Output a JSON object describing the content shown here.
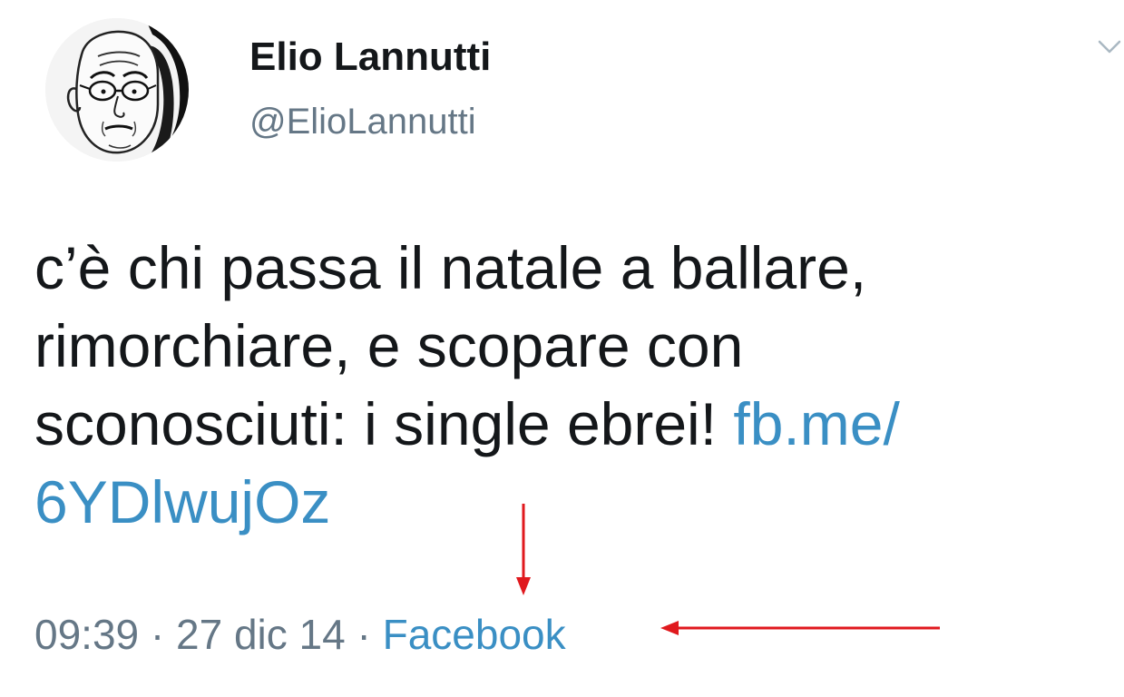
{
  "author": {
    "display_name": "Elio Lannutti",
    "handle": "@ElioLannutti",
    "avatar_icon": "caricature-portrait-avatar"
  },
  "menu": {
    "icon": "chevron-down-icon"
  },
  "tweet": {
    "line1": "c’è chi passa il natale a ballare,",
    "line2": "rimorchiare, e scopare con",
    "line3_text": "sconosciuti: i single ebrei! ",
    "link_part1": "fb.me/",
    "link_part2": "6YDlwujOz"
  },
  "meta": {
    "time": "09:39",
    "separator1": " · ",
    "date": "27 dic 14",
    "separator2": " · ",
    "source": "Facebook"
  },
  "colors": {
    "text": "#14171a",
    "muted": "#657786",
    "link": "#3a8fc4",
    "annotation_arrow": "#e0191e"
  }
}
